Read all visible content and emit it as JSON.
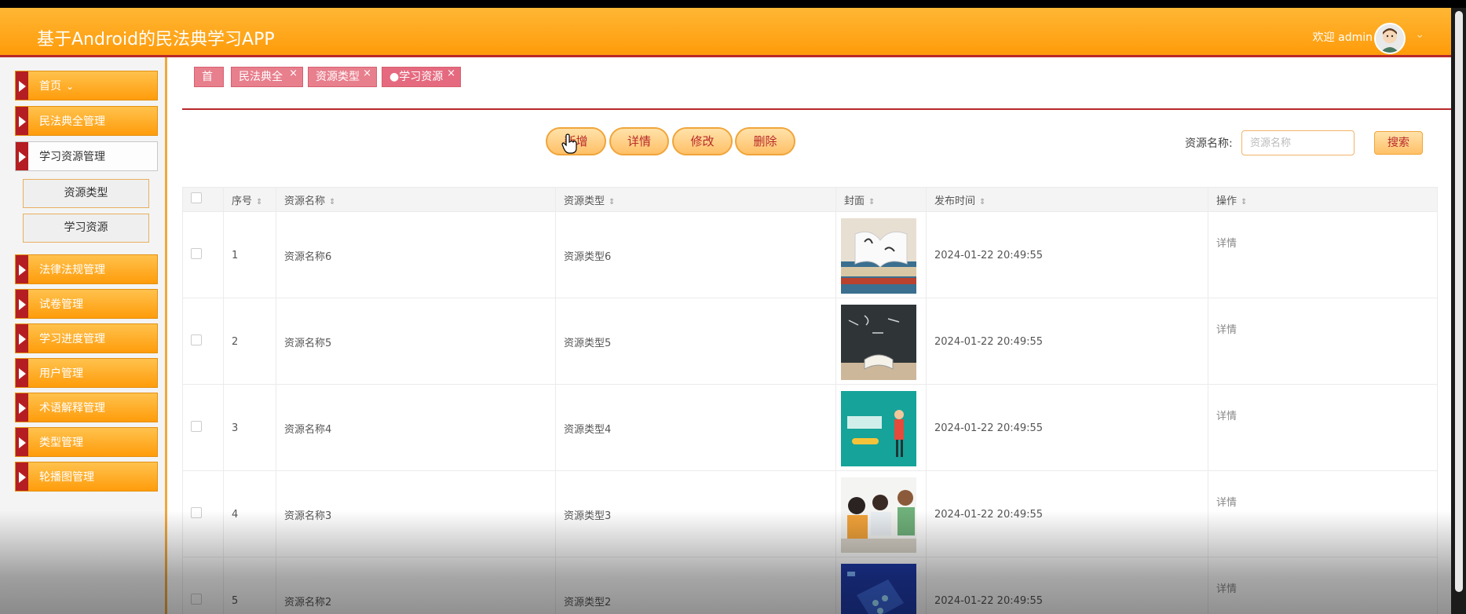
{
  "header": {
    "app_title": "基于Android的民法典学习APP",
    "welcome": "欢迎 admin",
    "brand_color": "#ff9b0a",
    "accent_color": "#b8292b"
  },
  "sidebar": {
    "home": "首页",
    "items": [
      {
        "label": "民法典全管理"
      },
      {
        "label": "学习资源管理"
      },
      {
        "label": "法律法规管理"
      },
      {
        "label": "试卷管理"
      },
      {
        "label": "学习进度管理"
      },
      {
        "label": "用户管理"
      },
      {
        "label": "术语解释管理"
      },
      {
        "label": "类型管理"
      },
      {
        "label": "轮播图管理"
      }
    ],
    "sub_items": [
      {
        "label": "资源类型"
      },
      {
        "label": "学习资源"
      }
    ]
  },
  "tabs": [
    {
      "label": "首页"
    },
    {
      "label": "民法典全"
    },
    {
      "label": "资源类型"
    },
    {
      "label": "●学习资源"
    }
  ],
  "toolbar": {
    "add": "新增",
    "detail": "详情",
    "edit": "修改",
    "delete": "删除"
  },
  "search": {
    "label": "资源名称:",
    "placeholder": "资源名称",
    "button": "搜索"
  },
  "table": {
    "headers": {
      "index": "序号",
      "name": "资源名称",
      "type": "资源类型",
      "cover": "封面",
      "time": "发布时间",
      "action": "操作"
    },
    "rows": [
      {
        "index": "1",
        "name": "资源名称6",
        "type": "资源类型6",
        "time": "2024-01-22 20:49:55",
        "action": "详情"
      },
      {
        "index": "2",
        "name": "资源名称5",
        "type": "资源类型5",
        "time": "2024-01-22 20:49:55",
        "action": "详情"
      },
      {
        "index": "3",
        "name": "资源名称4",
        "type": "资源类型4",
        "time": "2024-01-22 20:49:55",
        "action": "详情"
      },
      {
        "index": "4",
        "name": "资源名称3",
        "type": "资源类型3",
        "time": "2024-01-22 20:49:55",
        "action": "详情"
      },
      {
        "index": "5",
        "name": "资源名称2",
        "type": "资源类型2",
        "time": "2024-01-22 20:49:55",
        "action": "详情"
      }
    ]
  }
}
